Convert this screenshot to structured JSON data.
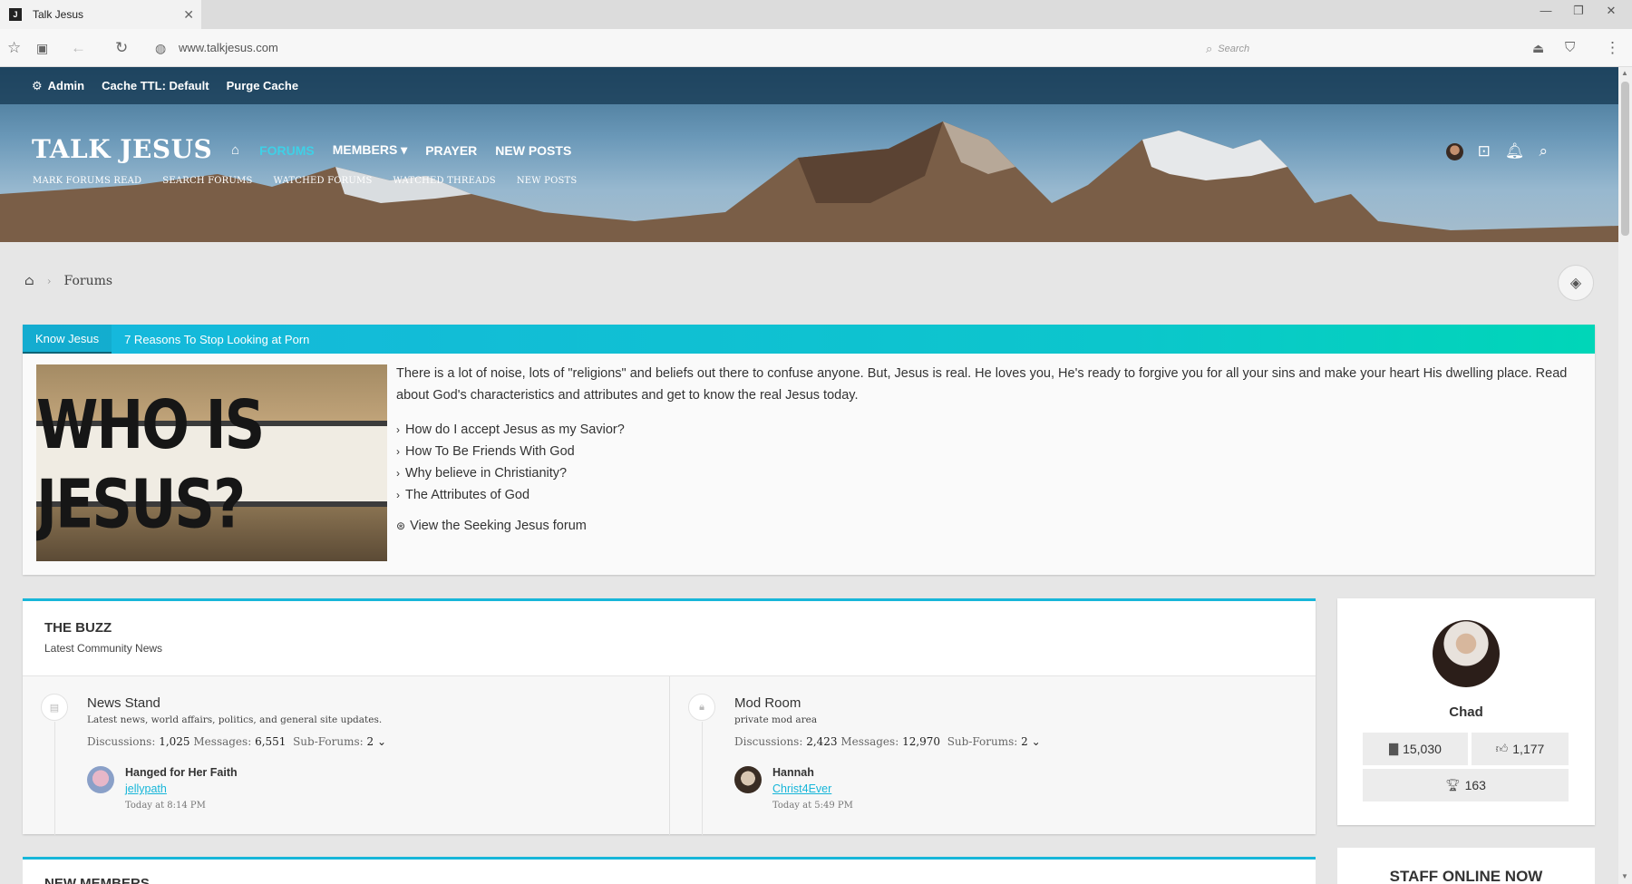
{
  "browser": {
    "tab_title": "Talk Jesus",
    "tab_favicon": "J",
    "url": "www.talkjesus.com",
    "search_placeholder": "Search"
  },
  "adminbar": {
    "items": [
      "Admin",
      "Cache TTL: Default",
      "Purge Cache"
    ]
  },
  "site": {
    "logo": "TALK JESUS",
    "nav": [
      {
        "label": "FORUMS",
        "active": true
      },
      {
        "label": "MEMBERS ▾",
        "active": false
      },
      {
        "label": "PRAYER",
        "active": false
      },
      {
        "label": "NEW POSTS",
        "active": false
      }
    ],
    "subnav": [
      "MARK FORUMS READ",
      "SEARCH FORUMS",
      "WATCHED FORUMS",
      "WATCHED THREADS",
      "NEW POSTS"
    ],
    "accent_color": "#17b6d9"
  },
  "breadcrumb": {
    "current": "Forums"
  },
  "know_jesus": {
    "tabs": [
      "Know Jesus",
      "7 Reasons To Stop Looking at Porn"
    ],
    "image_text": "WHO IS JESUS?",
    "intro": "There is a lot of noise, lots of \"religions\" and beliefs out there to confuse anyone. But, Jesus is real. He loves you, He's ready to forgive you for all your sins and make your heart His dwelling place. Read about God's characteristics and attributes and get to know the real Jesus today.",
    "links": [
      "How do I accept Jesus as my Savior?",
      "How To Be Friends With God",
      "Why believe in Christianity?",
      "The Attributes of God"
    ],
    "forum_link": "View the Seeking Jesus forum"
  },
  "buzz": {
    "title": "THE BUZZ",
    "subtitle": "Latest Community News",
    "nodes": [
      {
        "title": "News Stand",
        "description": "Latest news, world affairs, politics, and general site updates.",
        "discussions_label": "Discussions:",
        "discussions": "1,025",
        "messages_label": "Messages:",
        "messages": "6,551",
        "subforums_label": "Sub-Forums:",
        "subforums": "2 ⌄",
        "latest_title": "Hanged for Her Faith",
        "latest_user": "jellypath",
        "latest_time": "Today at 8:14 PM"
      },
      {
        "title": "Mod Room",
        "description": "private mod area",
        "discussions_label": "Discussions:",
        "discussions": "2,423",
        "messages_label": "Messages:",
        "messages": "12,970",
        "subforums_label": "Sub-Forums:",
        "subforums": "2 ⌄",
        "latest_title": "Hannah",
        "latest_user": "Christ4Ever",
        "latest_time": "Today at 5:49 PM"
      }
    ]
  },
  "next_section_title": "NEW MEMBERS",
  "profile": {
    "name": "Chad",
    "messages": "15,030",
    "likes": "1,177",
    "trophies": "163"
  },
  "staff_title": "STAFF ONLINE NOW"
}
